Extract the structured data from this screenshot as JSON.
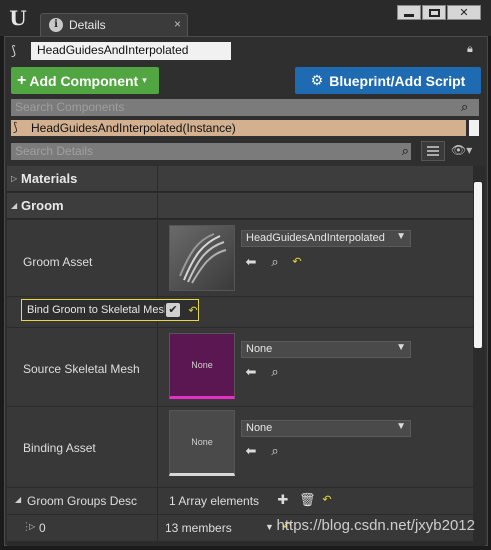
{
  "window": {
    "tab_title": "Details",
    "tab_close": "×",
    "logo": "U",
    "buttons": [
      "minimize",
      "maximize",
      "close"
    ],
    "close_glyph": "✕"
  },
  "actor": {
    "name": "HeadGuidesAndInterpolated"
  },
  "toolbar": {
    "add_component_label": "Add Component",
    "add_component_plus": "+",
    "add_component_caret": "▾",
    "blueprint_label": "Blueprint/Add Script"
  },
  "search_components": {
    "placeholder": "Search Components"
  },
  "instance": {
    "label": "HeadGuidesAndInterpolated(Instance)"
  },
  "search_details": {
    "placeholder": "Search Details"
  },
  "categories": {
    "materials": "Materials",
    "groom": "Groom"
  },
  "props": {
    "groom_asset": {
      "label": "Groom Asset",
      "value": "HeadGuidesAndInterpolated"
    },
    "bind_groom": {
      "label": "Bind Groom to Skeletal Mesh",
      "checked": "✔"
    },
    "source_mesh": {
      "label": "Source Skeletal Mesh",
      "value": "None",
      "thumb_label": "None"
    },
    "binding_asset": {
      "label": "Binding Asset",
      "value": "None",
      "thumb_label": "None"
    },
    "groom_groups": {
      "label": "Groom Groups Desc",
      "value": "1 Array elements"
    },
    "index0": {
      "label": "0",
      "value": "13 members"
    }
  },
  "colors": {
    "add_green": "#51a641",
    "blueprint_blue": "#1f6bb2",
    "instance_tan": "#d3b08f",
    "highlight_yellow": "#e6d84b",
    "mesh_purple": "#5b1751"
  },
  "watermark": "https://blog.csdn.net/jxyb2012"
}
